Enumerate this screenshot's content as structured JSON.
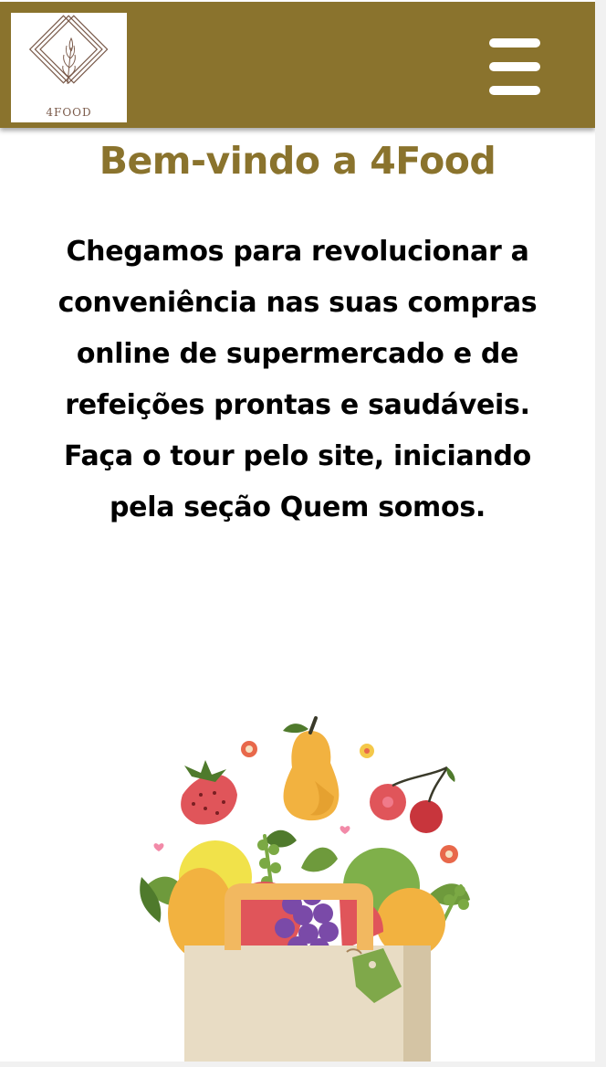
{
  "header": {
    "logo_text": "4FOOD",
    "menu_icon": "hamburger-menu-icon"
  },
  "main": {
    "title": "Bem-vindo a 4Food",
    "intro": "Chegamos para revolucionar a conveniência nas suas compras online de supermercado e de refeições prontas e saudáveis. Faça o tour pelo site, iniciando pela seção Quem somos.",
    "illustration_icon": "grocery-bag-fruits-illustration"
  },
  "colors": {
    "brand": "#8a732d",
    "background": "#ffffff",
    "text": "#000000"
  }
}
